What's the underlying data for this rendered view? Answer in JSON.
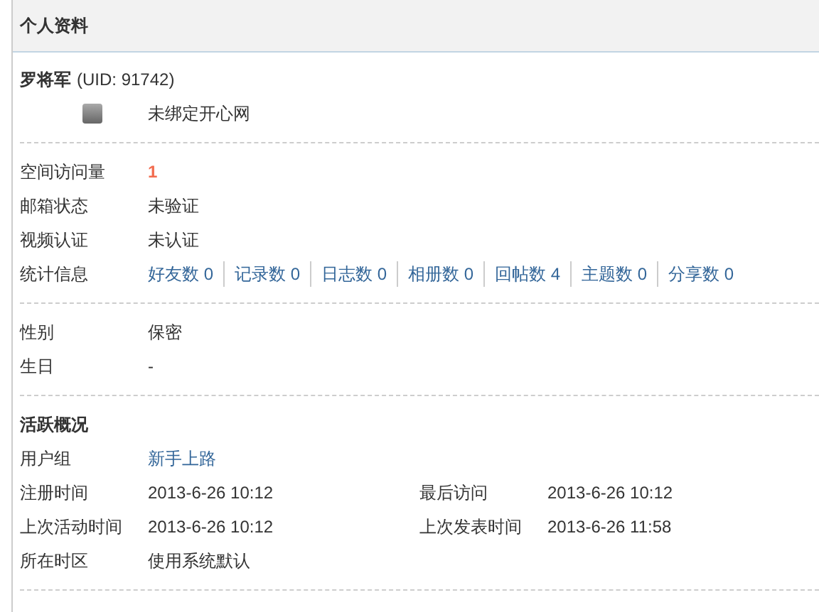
{
  "title": "个人资料",
  "user": {
    "name": "罗将军",
    "uid": "(UID: 91742)",
    "binding": "未绑定开心网"
  },
  "info": [
    {
      "label": "空间访问量",
      "value": "1",
      "kind": "count"
    },
    {
      "label": "邮箱状态",
      "value": "未验证",
      "kind": "text"
    },
    {
      "label": "视频认证",
      "value": "未认证",
      "kind": "text"
    }
  ],
  "stats": {
    "label": "统计信息",
    "items": [
      {
        "label": "好友数 0"
      },
      {
        "label": "记录数 0"
      },
      {
        "label": "日志数 0"
      },
      {
        "label": "相册数 0"
      },
      {
        "label": "回帖数 4"
      },
      {
        "label": "主题数 0"
      },
      {
        "label": "分享数 0"
      }
    ]
  },
  "profile": [
    {
      "label": "性别",
      "value": "保密"
    },
    {
      "label": "生日",
      "value": "-"
    }
  ],
  "activity": {
    "title": "活跃概况",
    "rows": [
      {
        "cells": [
          {
            "label": "用户组",
            "value": "新手上路",
            "kind": "link"
          }
        ]
      },
      {
        "cells": [
          {
            "label": "注册时间",
            "value": "2013-6-26 10:12",
            "kind": "text"
          },
          {
            "label": "最后访问",
            "value": "2013-6-26 10:12",
            "kind": "text"
          }
        ]
      },
      {
        "cells": [
          {
            "label": "上次活动时间",
            "value": "2013-6-26 10:12",
            "kind": "text"
          },
          {
            "label": "上次发表时间",
            "value": "2013-6-26 11:58",
            "kind": "text"
          }
        ]
      },
      {
        "cells": [
          {
            "label": "所在时区",
            "value": "使用系统默认",
            "kind": "text"
          }
        ]
      }
    ]
  }
}
